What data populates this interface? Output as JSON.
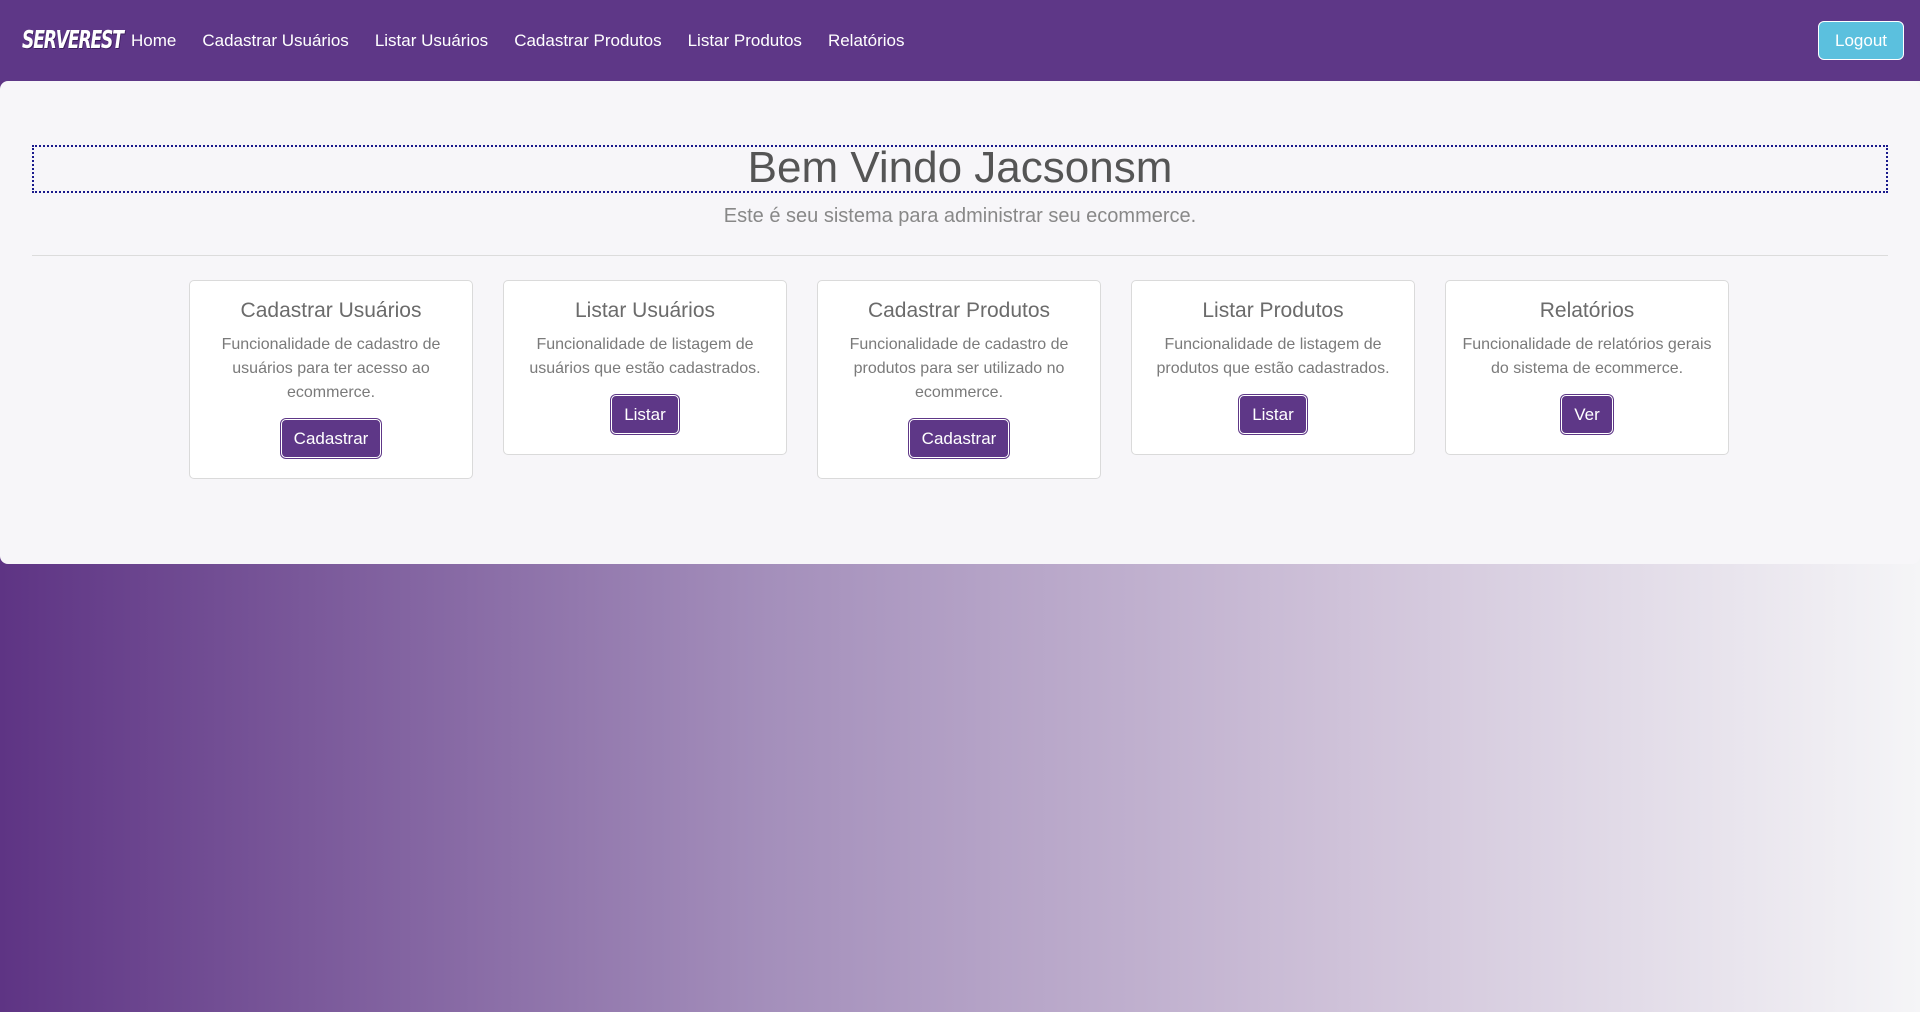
{
  "nav": {
    "brand": "SERVEREST",
    "links": [
      "Home",
      "Cadastrar Usuários",
      "Listar Usuários",
      "Cadastrar Produtos",
      "Listar Produtos",
      "Relatórios"
    ],
    "logout": "Logout"
  },
  "main": {
    "title": "Bem Vindo Jacsonsm",
    "subtitle": "Este é seu sistema para administrar seu ecommerce."
  },
  "cards": [
    {
      "title": "Cadastrar Usuários",
      "text": "Funcionalidade de cadastro de usuários para ter acesso ao ecommerce.",
      "button": "Cadastrar"
    },
    {
      "title": "Listar Usuários",
      "text": "Funcionalidade de listagem de usuários que estão cadastrados.",
      "button": "Listar"
    },
    {
      "title": "Cadastrar Produtos",
      "text": "Funcionalidade de cadastro de produtos para ser utilizado no ecommerce.",
      "button": "Cadastrar"
    },
    {
      "title": "Listar Produtos",
      "text": "Funcionalidade de listagem de produtos que estão cadastrados.",
      "button": "Listar"
    },
    {
      "title": "Relatórios",
      "text": "Funcionalidade de relatórios gerais do sistema de ecommerce.",
      "button": "Ver"
    }
  ],
  "colors": {
    "primary": "#5e3787",
    "logout": "#5bc0de",
    "content_bg": "#f7f6f9"
  }
}
